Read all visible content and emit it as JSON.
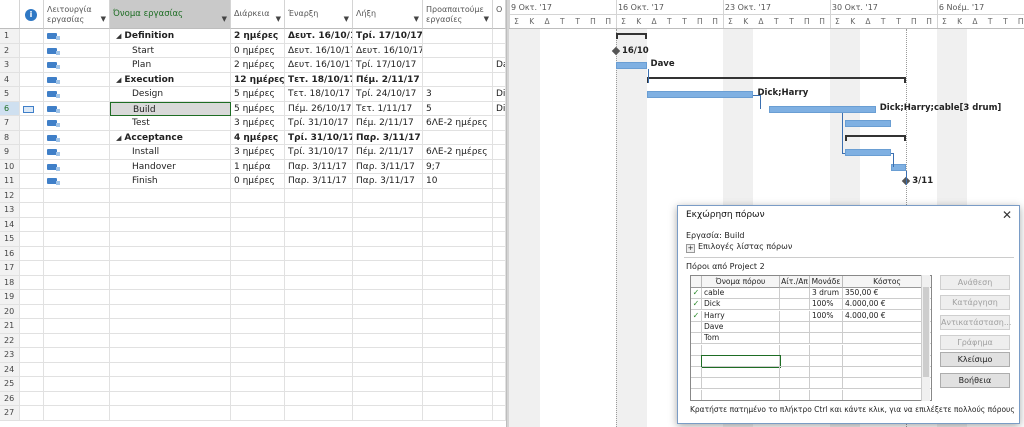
{
  "grid": {
    "headers": {
      "mode": "Λειτουργία εργασίας",
      "name": "Όνομα εργασίας",
      "duration": "Διάρκεια",
      "start": "Έναρξη",
      "finish": "Λήξη",
      "predecessors": "Προαπαιτούμε εργασίες",
      "resources": "Ο"
    },
    "row_numbers": [
      "1",
      "2",
      "3",
      "4",
      "5",
      "6",
      "7",
      "8",
      "9",
      "10",
      "11",
      "12",
      "13",
      "14",
      "15",
      "16",
      "17",
      "18",
      "19",
      "20",
      "21",
      "22",
      "23",
      "24",
      "25",
      "26",
      "27"
    ],
    "rows": [
      {
        "name": "Definition",
        "duration": "2 ημέρες",
        "start": "Δευτ. 16/10/17",
        "finish": "Τρί. 17/10/17",
        "predecessors": "",
        "res": ""
      },
      {
        "name": "Start",
        "duration": "0 ημέρες",
        "start": "Δευτ. 16/10/17",
        "finish": "Δευτ. 16/10/17",
        "predecessors": "",
        "res": ""
      },
      {
        "name": "Plan",
        "duration": "2 ημέρες",
        "start": "Δευτ. 16/10/17",
        "finish": "Τρί. 17/10/17",
        "predecessors": "",
        "res": "Da"
      },
      {
        "name": "Execution",
        "duration": "12 ημέρες",
        "start": "Τετ. 18/10/17",
        "finish": "Πέμ. 2/11/17",
        "predecessors": "",
        "res": ""
      },
      {
        "name": "Design",
        "duration": "5 ημέρες",
        "start": "Τετ. 18/10/17",
        "finish": "Τρί. 24/10/17",
        "predecessors": "3",
        "res": "Di"
      },
      {
        "name": "Build",
        "duration": "5 ημέρες",
        "start": "Πέμ. 26/10/17",
        "finish": "Τετ. 1/11/17",
        "predecessors": "5",
        "res": "Di"
      },
      {
        "name": "Test",
        "duration": "3 ημέρες",
        "start": "Τρί. 31/10/17",
        "finish": "Πέμ. 2/11/17",
        "predecessors": "6ΛΕ-2 ημέρες",
        "res": ""
      },
      {
        "name": "Acceptance",
        "duration": "4 ημέρες",
        "start": "Τρί. 31/10/17",
        "finish": "Παρ. 3/11/17",
        "predecessors": "",
        "res": ""
      },
      {
        "name": "Install",
        "duration": "3 ημέρες",
        "start": "Τρί. 31/10/17",
        "finish": "Πέμ. 2/11/17",
        "predecessors": "6ΛΕ-2 ημέρες",
        "res": ""
      },
      {
        "name": "Handover",
        "duration": "1 ημέρα",
        "start": "Παρ. 3/11/17",
        "finish": "Παρ. 3/11/17",
        "predecessors": "9;7",
        "res": ""
      },
      {
        "name": "Finish",
        "duration": "0 ημέρες",
        "start": "Παρ. 3/11/17",
        "finish": "Παρ. 3/11/17",
        "predecessors": "10",
        "res": ""
      }
    ]
  },
  "gantt": {
    "weeks": [
      "9 Οκτ. '17",
      "16 Οκτ. '17",
      "23 Οκτ. '17",
      "30 Οκτ. '17",
      "6 Νοέμ. '17"
    ],
    "days": [
      "Σ",
      "Κ",
      "Δ",
      "Τ",
      "Τ",
      "Π",
      "Π",
      "Σ",
      "Κ",
      "Δ",
      "Τ",
      "Τ",
      "Π",
      "Π",
      "Σ",
      "Κ",
      "Δ",
      "Τ",
      "Τ",
      "Π",
      "Π",
      "Σ",
      "Κ",
      "Δ",
      "Τ",
      "Τ",
      "Π",
      "Π",
      "Σ",
      "Κ",
      "Δ",
      "Τ",
      "Τ",
      "Π",
      "Π"
    ],
    "labels": {
      "start": "16/10",
      "plan": "Dave",
      "design": "Dick;Harry",
      "build": "Dick;Harry;cable[3 drum]",
      "finish": "3/11"
    }
  },
  "dialog": {
    "title": "Εκχώρηση πόρων",
    "close": "✕",
    "task_label": "Εργασία: Build",
    "options_label": "Επιλογές λίστας πόρων",
    "group_label": "Πόροι από Project 2",
    "columns": [
      "Όνομα πόρου",
      "Αίτ./Απ",
      "Μονάδε",
      "Κόστος"
    ],
    "resources": [
      {
        "assigned": true,
        "name": "cable",
        "req": "",
        "units": "3 drum",
        "cost": "350,00 €"
      },
      {
        "assigned": true,
        "name": "Dick",
        "req": "",
        "units": "100%",
        "cost": "4.000,00 €"
      },
      {
        "assigned": true,
        "name": "Harry",
        "req": "",
        "units": "100%",
        "cost": "4.000,00 €"
      },
      {
        "assigned": false,
        "name": "Dave",
        "req": "",
        "units": "",
        "cost": ""
      },
      {
        "assigned": false,
        "name": "Tom",
        "req": "",
        "units": "",
        "cost": ""
      }
    ],
    "buttons": {
      "assign": "Ανάθεση",
      "remove": "Κατάργηση",
      "replace": "Αντικατάσταση...",
      "graphs": "Γράφημα",
      "close": "Κλείσιμο",
      "help": "Βοήθεια"
    },
    "hint": "Κρατήστε πατημένο το πλήκτρο Ctrl και κάντε κλικ, για να επιλέξετε πολλούς πόρους"
  }
}
